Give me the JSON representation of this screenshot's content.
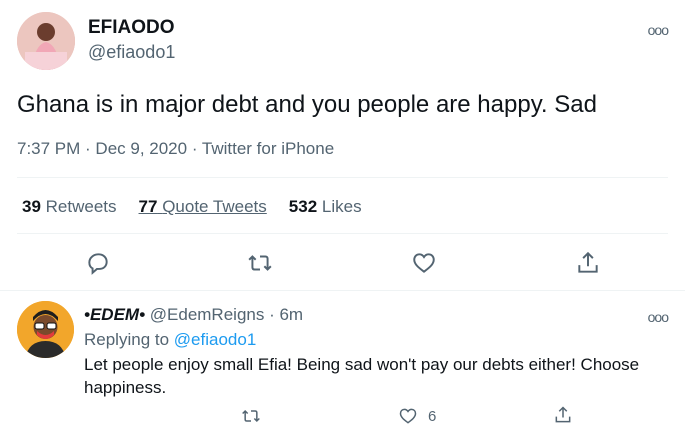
{
  "tweet": {
    "display_name": "EFIAODO",
    "handle": "@efiaodo1",
    "text": "Ghana is in major debt and you people are happy. Sad",
    "meta": "7:37 PM · Dec 9, 2020 · Twitter for iPhone",
    "more_icon": "ooo",
    "stats": {
      "retweets_count": "39",
      "retweets_label": "Retweets",
      "quote_count": "77",
      "quote_label": "Quote Tweets",
      "likes_count": "532",
      "likes_label": "Likes"
    },
    "actions": [
      "reply-icon",
      "retweet-icon",
      "like-icon",
      "share-icon"
    ]
  },
  "reply": {
    "display_name": "•EDEM•",
    "handle_time": "@EdemReigns · 6m",
    "replying_prefix": "Replying to",
    "replying_handle": "@efiaodo1",
    "text": "Let people enjoy small Efia! Being sad won't pay our debts either! Choose happiness.",
    "like_count": "6",
    "more_icon": "ooo"
  },
  "colors": {
    "accent": "#1d9bf0",
    "muted": "#536471",
    "text": "#0f1419"
  }
}
